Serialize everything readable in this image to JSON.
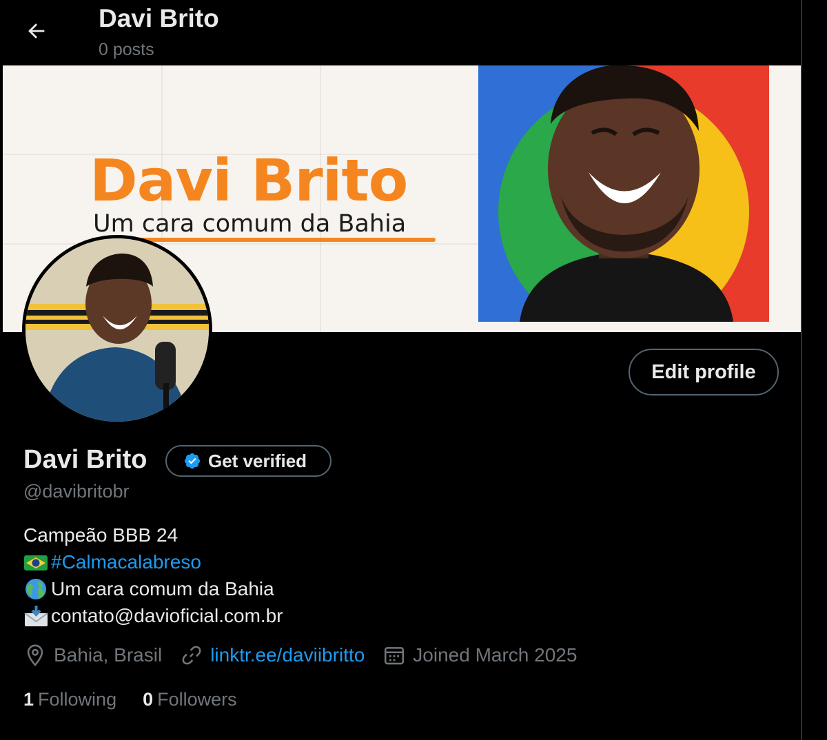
{
  "header": {
    "name": "Davi Brito",
    "posts": "0 posts"
  },
  "banner": {
    "title": "Davi Brito",
    "subtitle": "Um cara comum da Bahia"
  },
  "profile": {
    "name": "Davi Brito",
    "verify_label": "Get verified",
    "handle": "@davibritobr",
    "edit_label": "Edit profile"
  },
  "bio": {
    "line1": "Campeão BBB 24",
    "line2": "#Calmacalabreso",
    "line3": "Um cara comum da Bahia",
    "line4": "contato@davioficial.com.br"
  },
  "meta": {
    "location": "Bahia, Brasil",
    "link": "linktr.ee/daviibritto",
    "joined": "Joined March 2025"
  },
  "counts": {
    "following_num": "1",
    "following_label": "Following",
    "followers_num": "0",
    "followers_label": "Followers"
  },
  "icons": {
    "back": "arrow-left-icon",
    "verified": "verified-badge-icon",
    "location": "location-pin-icon",
    "link": "link-icon",
    "calendar": "calendar-icon",
    "flag": "brazil-flag-icon",
    "globe": "globe-icon",
    "mail": "envelope-icon"
  },
  "colors": {
    "background": "#000000",
    "text": "#e7e9ea",
    "muted": "#71767b",
    "accent": "#1d9bf0",
    "border": "#536471",
    "banner_orange": "#f5861f"
  }
}
